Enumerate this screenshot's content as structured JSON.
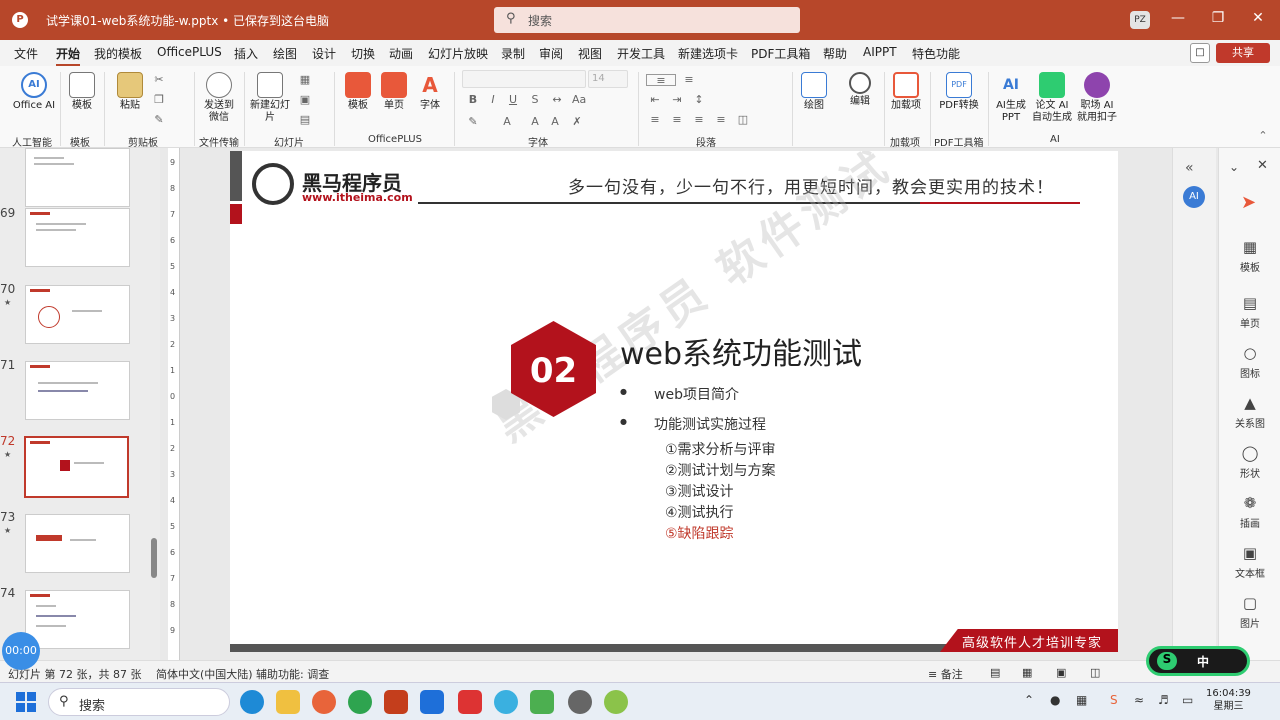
{
  "titlebar": {
    "doc_title": "试学课01-web系统功能-w.pptx • 已保存到这台电脑",
    "search_placeholder": "搜索",
    "avatar": "PZ"
  },
  "menu": [
    "文件",
    "开始",
    "我的模板",
    "OfficePLUS",
    "插入",
    "绘图",
    "设计",
    "切换",
    "动画",
    "幻灯片放映",
    "录制",
    "审阅",
    "视图",
    "开发工具",
    "新建选项卡",
    "PDF工具箱",
    "帮助",
    "AIPPT",
    "特色功能"
  ],
  "share_label": "共享",
  "ribbon": {
    "buttons": {
      "office_ai": "Office AI",
      "template": "模板",
      "paste": "粘贴",
      "send_wechat": "发送到微信",
      "new_slide": "新建幻灯片",
      "template2": "模板",
      "single_page": "单页",
      "font": "字体",
      "draw": "绘图",
      "edit": "编辑",
      "addin": "加载项",
      "pdf_convert": "PDF转换",
      "ai_ppt": "AI生成PPT",
      "thesis_ai": "论文 AI 自动生成",
      "job_ai": "职场 AI 就用扣子"
    },
    "groups": {
      "ai": "人工智能",
      "template": "模板",
      "clipboard": "剪贴板",
      "file_transfer": "文件传输",
      "slides": "幻灯片",
      "officeplus": "OfficePLUS",
      "font": "字体",
      "paragraph": "段落",
      "addins": "加载项",
      "pdf_tools": "PDF工具箱",
      "ai2": "AI"
    },
    "font_size": "14"
  },
  "thumbnails": [
    {
      "num": "",
      "star": false
    },
    {
      "num": "69",
      "star": false
    },
    {
      "num": "70",
      "star": true
    },
    {
      "num": "71",
      "star": false
    },
    {
      "num": "72",
      "star": true,
      "selected": true
    },
    {
      "num": "73",
      "star": true
    },
    {
      "num": "74",
      "star": false
    }
  ],
  "ruler_marks": [
    "9",
    "8",
    "7",
    "6",
    "5",
    "4",
    "3",
    "2",
    "1",
    "0",
    "1",
    "2",
    "3",
    "4",
    "5",
    "6",
    "7",
    "8",
    "9"
  ],
  "slide": {
    "brand": "黑马程序员",
    "url": "www.itheima.com",
    "slogan": "多一句没有，少一句不行，用更短时间，教会更实用的技术！",
    "number": "02",
    "title": "web系统功能测试",
    "bullets": [
      "web项目简介",
      "功能测试实施过程"
    ],
    "subitems": [
      "①需求分析与评审",
      "②测试计划与方案",
      "③测试设计",
      "④测试执行",
      "⑤缺陷跟踪"
    ],
    "watermark": "黑马程序员 软件测试",
    "footer": "高级软件人才培训专家",
    "colors": {
      "accent": "#b3121c",
      "highlight": "#c0392b"
    }
  },
  "side_panel": [
    "模板",
    "单页",
    "图标",
    "关系图",
    "形状",
    "插画",
    "文本框",
    "图片"
  ],
  "status": {
    "slide_info": "幻灯片 第 72 张，共 87 张",
    "language": "简体中文(中国大陆)",
    "accessibility": "辅助功能: 调查",
    "notes": "备注"
  },
  "timer": "00:00",
  "sougou": {
    "s": "S",
    "zh": "中"
  },
  "taskbar": {
    "search": "搜索",
    "time": "16:04:39",
    "weekday": "星期三"
  }
}
